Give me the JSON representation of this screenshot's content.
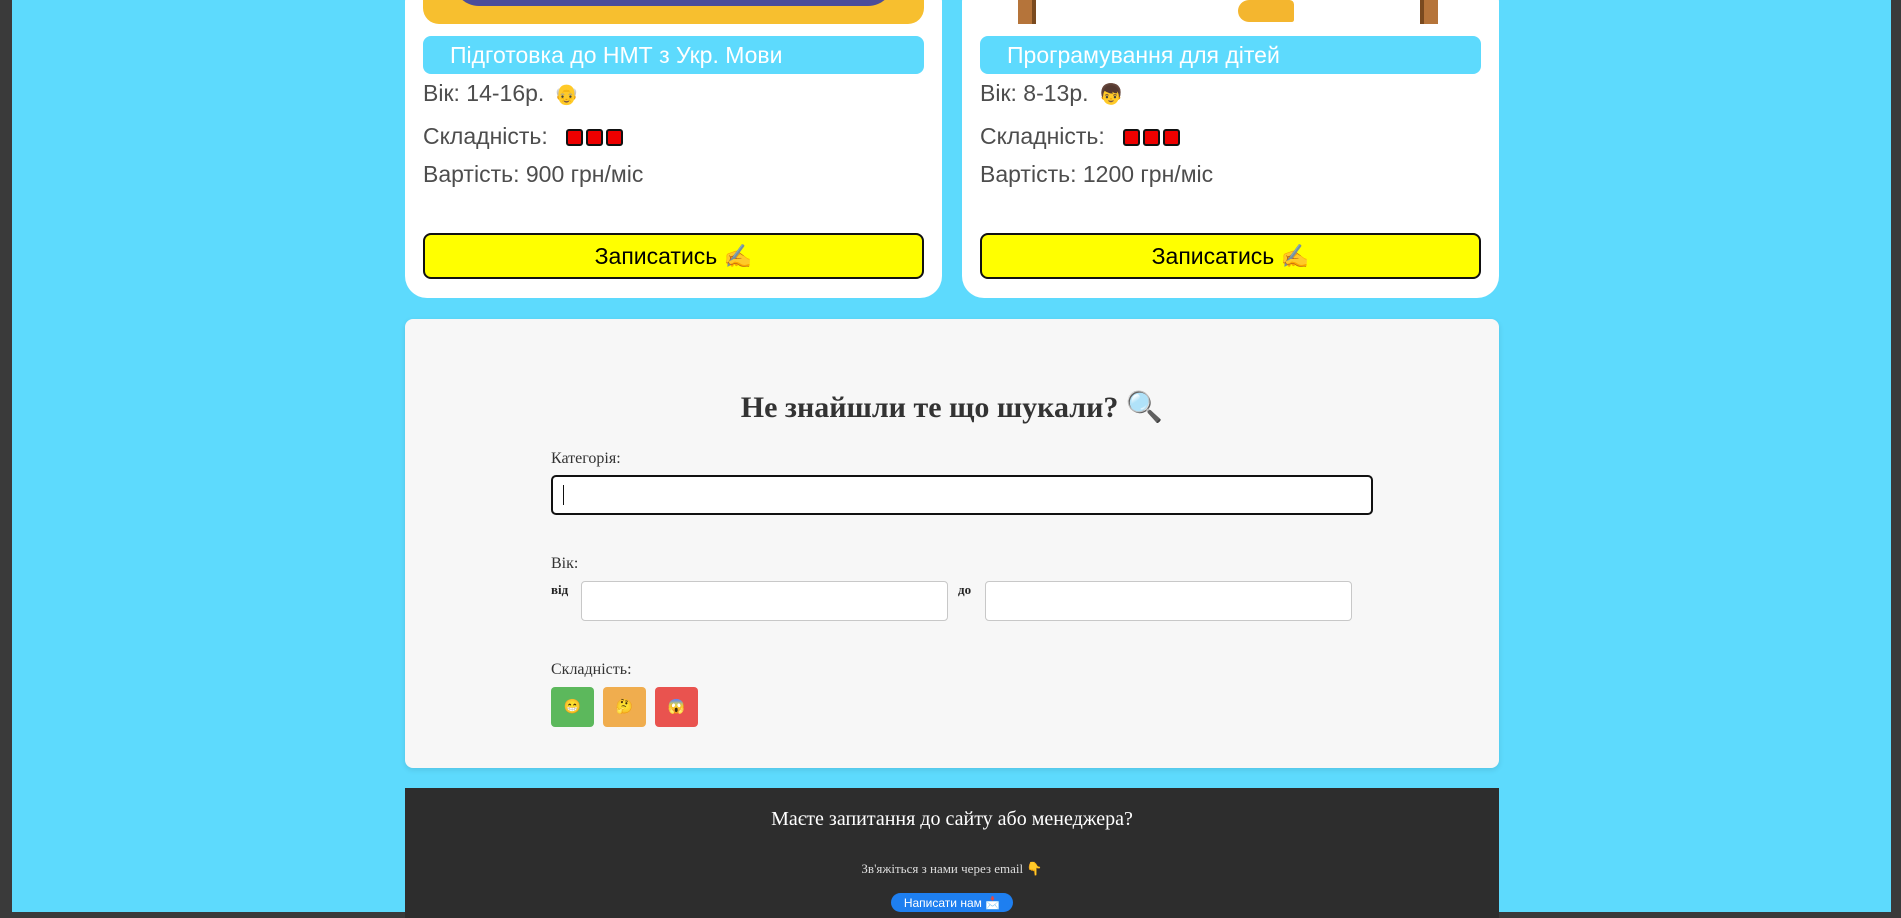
{
  "courses": [
    {
      "title": "Підготовка до НМТ з Укр. Мови",
      "age": "Вік: 14-16р.",
      "age_emoji": "👴",
      "difficulty_label": "Складність:",
      "difficulty_level": 3,
      "price": "Вартість: 900 грн/міс",
      "button": "Записатись ✍️"
    },
    {
      "title": "Програмування для дітей",
      "age": "Вік: 8-13р.",
      "age_emoji": "👦",
      "difficulty_label": "Складність:",
      "difficulty_level": 3,
      "price": "Вартість: 1200 грн/міс",
      "button": "Записатись ✍️"
    }
  ],
  "search": {
    "title": "Не знайшли те що шукали? 🔍",
    "category_label": "Категорія:",
    "category_value": "",
    "age_label": "Вік:",
    "from_label": "від",
    "to_label": "до",
    "from_value": "",
    "to_value": "",
    "difficulty_label": "Складність:",
    "difficulty_buttons": [
      {
        "emoji": "😁",
        "color": "#5cb85c"
      },
      {
        "emoji": "🤔",
        "color": "#f0ad4e"
      },
      {
        "emoji": "😱",
        "color": "#e9534f"
      }
    ]
  },
  "footer": {
    "title": "Маєте запитання до сайту або менеджера?",
    "subtitle": "Зв'яжіться з нами через email 👇",
    "button": "Написати нам 📩"
  },
  "colors": {
    "background": "#5ddafd",
    "enroll_button": "#ffff00",
    "difficulty_square": "#ee0000",
    "footer_bg": "#2d2d2d",
    "footer_button": "#1e7ff0"
  }
}
